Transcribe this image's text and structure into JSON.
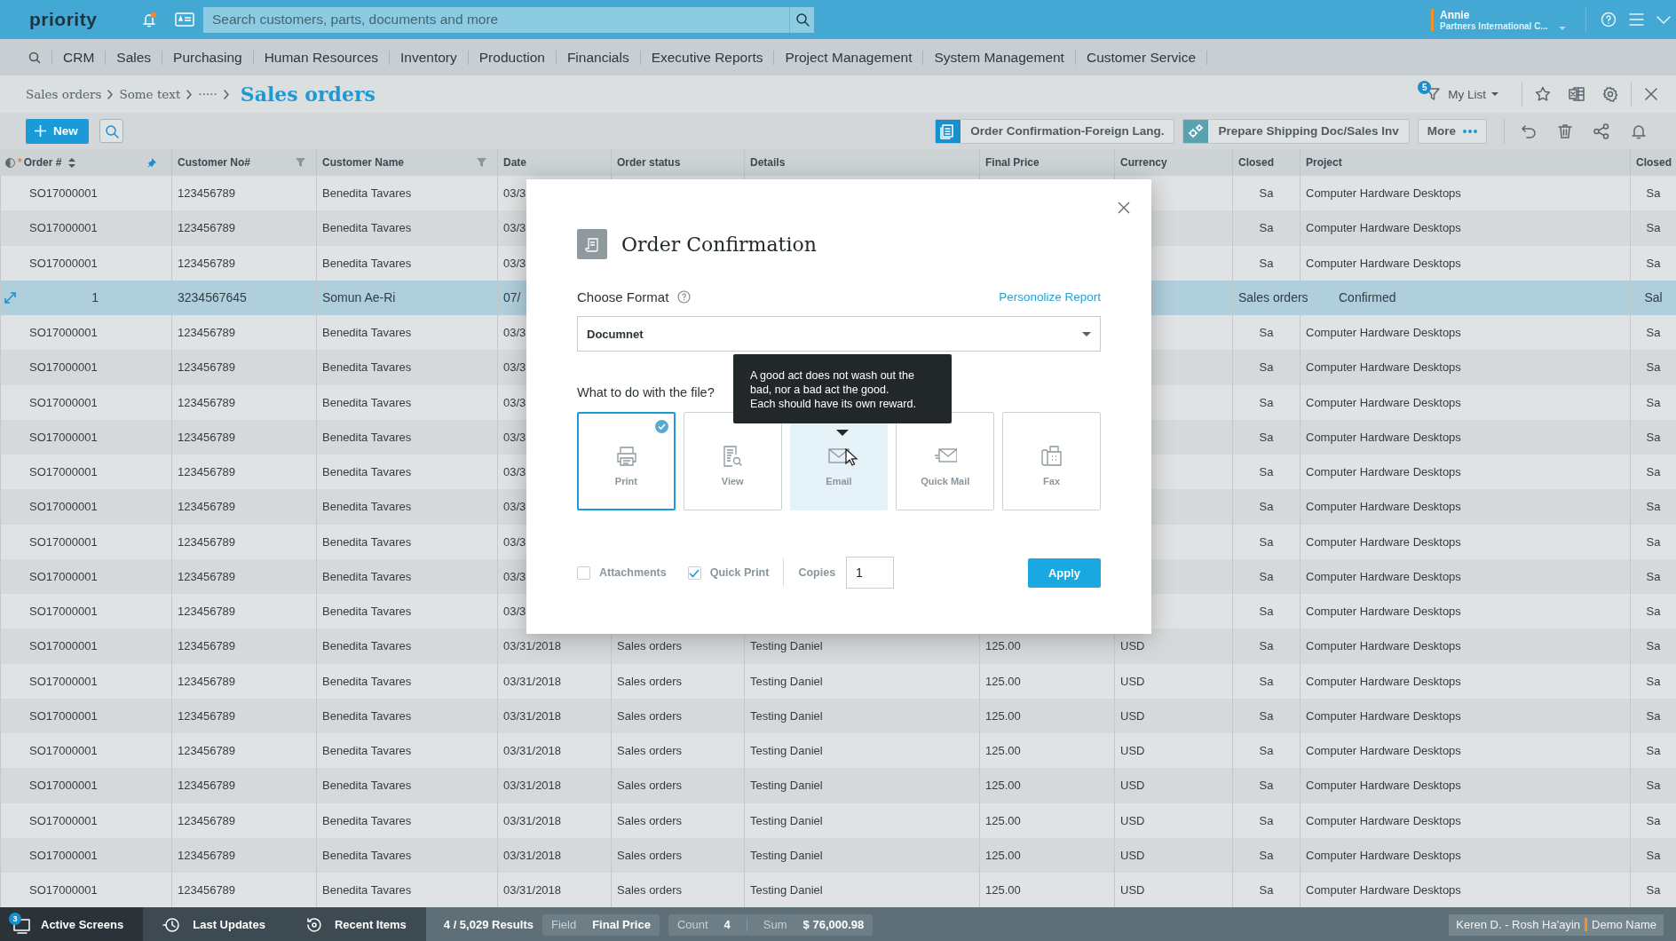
{
  "top_bar": {
    "logo": "priority",
    "search": {
      "placeholder": "Search customers, parts, documents and more"
    },
    "user": {
      "name": "Annie",
      "company": "Partners International C..."
    }
  },
  "nav": {
    "items": [
      "CRM",
      "Sales",
      "Purchasing",
      "Human Resources",
      "Inventory",
      "Production",
      "Financials",
      "Executive Reports",
      "Project Management",
      "System Management",
      "Customer Service"
    ]
  },
  "breadcrumb": {
    "items": [
      "Sales orders",
      "Some text",
      "·····"
    ],
    "title": "Sales orders"
  },
  "list_menu": {
    "badge": "5",
    "label": "My List"
  },
  "toolbar": {
    "new_button": "New",
    "actions": [
      {
        "label": "Order Confirmation-Foreign Lang.",
        "kind": "document"
      },
      {
        "label": "Prepare Shipping Doc/Sales Inv",
        "kind": "gears"
      }
    ],
    "more": "More"
  },
  "table": {
    "columns": [
      {
        "label": "Order #",
        "prefix": "*",
        "filter": false
      },
      {
        "label": "Customer No#",
        "filter": true
      },
      {
        "label": "Customer Name",
        "filter": true
      },
      {
        "label": "Date",
        "filter": false
      },
      {
        "label": "Order status",
        "filter": false
      },
      {
        "label": "Details",
        "filter": false
      },
      {
        "label": "Final Price",
        "filter": false
      },
      {
        "label": "Currency",
        "filter": false
      },
      {
        "label": "Closed",
        "filter": false
      },
      {
        "label": "Project",
        "filter": false
      },
      {
        "label": "Closed",
        "filter": false
      }
    ],
    "rows": [
      {
        "order": "SO17000001",
        "customer_no": "123456789",
        "customer_name": "Benedita Tavares",
        "date": "03/3",
        "closed": "Sa",
        "project": "Computer Hardware Desktops",
        "closed_2": "Sa",
        "selected": false
      },
      {
        "order": "SO17000001",
        "customer_no": "123456789",
        "customer_name": "Benedita Tavares",
        "date": "03/3",
        "closed": "Sa",
        "project": "Computer Hardware Desktops",
        "closed_2": "Sa",
        "selected": false
      },
      {
        "order": "SO17000001",
        "customer_no": "123456789",
        "customer_name": "Benedita Tavares",
        "date": "03/3",
        "closed": "Sa",
        "project": "Computer Hardware Desktops",
        "closed_2": "Sa",
        "selected": false
      },
      {
        "order": "1",
        "customer_no": "3234567645",
        "customer_name": "Somun Ae-Ri",
        "date": "07/",
        "closed": "Sales orders",
        "project": "Confirmed",
        "closed_2": "Sal",
        "selected": true
      },
      {
        "order": "SO17000001",
        "customer_no": "123456789",
        "customer_name": "Benedita Tavares",
        "date": "03/3",
        "closed": "Sa",
        "project": "Computer Hardware Desktops",
        "closed_2": "Sa",
        "selected": false
      },
      {
        "order": "SO17000001",
        "customer_no": "123456789",
        "customer_name": "Benedita Tavares",
        "date": "03/3",
        "closed": "Sa",
        "project": "Computer Hardware Desktops",
        "closed_2": "Sa",
        "selected": false
      },
      {
        "order": "SO17000001",
        "customer_no": "123456789",
        "customer_name": "Benedita Tavares",
        "date": "03/3",
        "closed": "Sa",
        "project": "Computer Hardware Desktops",
        "closed_2": "Sa",
        "selected": false
      },
      {
        "order": "SO17000001",
        "customer_no": "123456789",
        "customer_name": "Benedita Tavares",
        "date": "03/3",
        "closed": "Sa",
        "project": "Computer Hardware Desktops",
        "closed_2": "Sa",
        "selected": false
      },
      {
        "order": "SO17000001",
        "customer_no": "123456789",
        "customer_name": "Benedita Tavares",
        "date": "03/3",
        "closed": "Sa",
        "project": "Computer Hardware Desktops",
        "closed_2": "Sa",
        "selected": false
      },
      {
        "order": "SO17000001",
        "customer_no": "123456789",
        "customer_name": "Benedita Tavares",
        "date": "03/3",
        "closed": "Sa",
        "project": "Computer Hardware Desktops",
        "closed_2": "Sa",
        "selected": false
      },
      {
        "order": "SO17000001",
        "customer_no": "123456789",
        "customer_name": "Benedita Tavares",
        "date": "03/3",
        "closed": "Sa",
        "project": "Computer Hardware Desktops",
        "closed_2": "Sa",
        "selected": false
      },
      {
        "order": "SO17000001",
        "customer_no": "123456789",
        "customer_name": "Benedita Tavares",
        "date": "03/3",
        "closed": "Sa",
        "project": "Computer Hardware Desktops",
        "closed_2": "Sa",
        "selected": false
      },
      {
        "order": "SO17000001",
        "customer_no": "123456789",
        "customer_name": "Benedita Tavares",
        "date": "03/3",
        "closed": "Sa",
        "project": "Computer Hardware Desktops",
        "closed_2": "Sa",
        "selected": false
      },
      {
        "order": "SO17000001",
        "customer_no": "123456789",
        "customer_name": "Benedita Tavares",
        "date": "03/31/2018",
        "order_status": "Sales orders",
        "details": "Testing Daniel",
        "final_price": "125.00",
        "currency": "USD",
        "closed": "Sa",
        "project": "Computer Hardware Desktops",
        "closed_2": "Sa",
        "selected": false
      },
      {
        "order": "SO17000001",
        "customer_no": "123456789",
        "customer_name": "Benedita Tavares",
        "date": "03/31/2018",
        "order_status": "Sales orders",
        "details": "Testing Daniel",
        "final_price": "125.00",
        "currency": "USD",
        "closed": "Sa",
        "project": "Computer Hardware Desktops",
        "closed_2": "Sa",
        "selected": false
      },
      {
        "order": "SO17000001",
        "customer_no": "123456789",
        "customer_name": "Benedita Tavares",
        "date": "03/31/2018",
        "order_status": "Sales orders",
        "details": "Testing Daniel",
        "final_price": "125.00",
        "currency": "USD",
        "closed": "Sa",
        "project": "Computer Hardware Desktops",
        "closed_2": "Sa",
        "selected": false
      },
      {
        "order": "SO17000001",
        "customer_no": "123456789",
        "customer_name": "Benedita Tavares",
        "date": "03/31/2018",
        "order_status": "Sales orders",
        "details": "Testing Daniel",
        "final_price": "125.00",
        "currency": "USD",
        "closed": "Sa",
        "project": "Computer Hardware Desktops",
        "closed_2": "Sa",
        "selected": false
      },
      {
        "order": "SO17000001",
        "customer_no": "123456789",
        "customer_name": "Benedita Tavares",
        "date": "03/31/2018",
        "order_status": "Sales orders",
        "details": "Testing Daniel",
        "final_price": "125.00",
        "currency": "USD",
        "closed": "Sa",
        "project": "Computer Hardware Desktops",
        "closed_2": "Sa",
        "selected": false
      },
      {
        "order": "SO17000001",
        "customer_no": "123456789",
        "customer_name": "Benedita Tavares",
        "date": "03/31/2018",
        "order_status": "Sales orders",
        "details": "Testing Daniel",
        "final_price": "125.00",
        "currency": "USD",
        "closed": "Sa",
        "project": "Computer Hardware Desktops",
        "closed_2": "Sa",
        "selected": false
      },
      {
        "order": "SO17000001",
        "customer_no": "123456789",
        "customer_name": "Benedita Tavares",
        "date": "03/31/2018",
        "order_status": "Sales orders",
        "details": "Testing Daniel",
        "final_price": "125.00",
        "currency": "USD",
        "closed": "Sa",
        "project": "Computer Hardware Desktops",
        "closed_2": "Sa",
        "selected": false
      },
      {
        "order": "SO17000001",
        "customer_no": "123456789",
        "customer_name": "Benedita Tavares",
        "date": "03/31/2018",
        "order_status": "Sales orders",
        "details": "Testing Daniel",
        "final_price": "125.00",
        "currency": "USD",
        "closed": "Sa",
        "project": "Computer Hardware Desktops",
        "closed_2": "Sa",
        "selected": false
      }
    ]
  },
  "dialog": {
    "title": "Order Confirmation",
    "format_label": "Choose Format",
    "personalize_link": "Personolize Report",
    "format": {
      "value": "Documnet"
    },
    "question": "What to do with the file?",
    "tooltip": "A good act does not wash out the\nbad, nor a bad act the good.\nEach should have its own reward.",
    "options": [
      {
        "label": "Print",
        "kind": "print",
        "selected": true,
        "hovered": false
      },
      {
        "label": "View",
        "kind": "view",
        "selected": false,
        "hovered": false
      },
      {
        "label": "Email",
        "kind": "email",
        "selected": false,
        "hovered": true
      },
      {
        "label": "Quick Mail",
        "kind": "quickmail",
        "selected": false,
        "hovered": false
      },
      {
        "label": "Fax",
        "kind": "fax",
        "selected": false,
        "hovered": false
      }
    ],
    "checkboxes": [
      {
        "label": "Attachments",
        "checked": false
      },
      {
        "label": "Quick Print",
        "checked": true
      }
    ],
    "copies": {
      "label": "Copies",
      "value": "1"
    },
    "apply_button": "Apply"
  },
  "status_bar": {
    "tabs": [
      {
        "label": "Active Screens",
        "badge": "3",
        "kind": "screens",
        "selected": true
      },
      {
        "label": "Last Updates",
        "kind": "updates",
        "selected": false
      },
      {
        "label": "Recent Items",
        "kind": "recent",
        "selected": false
      }
    ],
    "results": "4 / 5,029 Results",
    "field": {
      "label": "Field",
      "value": "Final Price"
    },
    "count": {
      "label": "Count",
      "value": "4"
    },
    "sum": {
      "label": "Sum",
      "value": "$ 76,000.98"
    },
    "location": "Keren D. - Rosh Ha'ayin",
    "environment": "Demo Name"
  }
}
